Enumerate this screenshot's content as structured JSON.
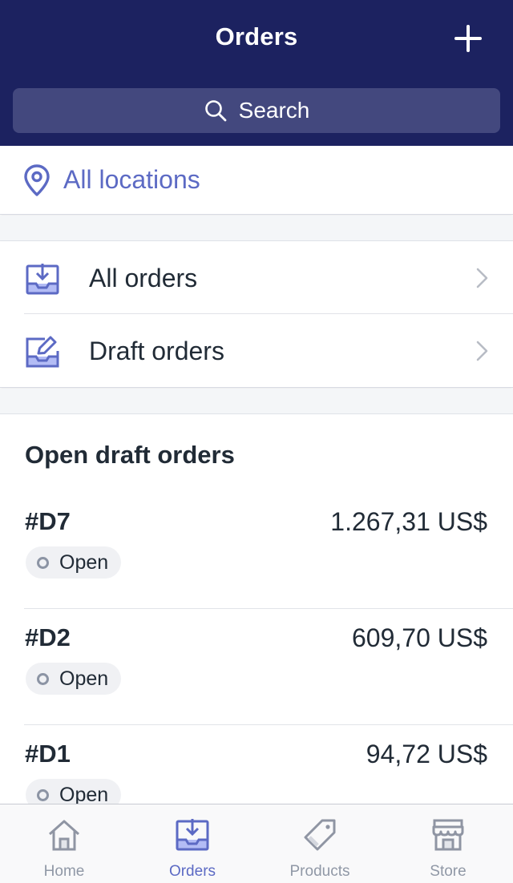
{
  "header": {
    "title": "Orders",
    "add_icon": "plus-icon",
    "search_placeholder": "Search",
    "background_color": "#1c2260"
  },
  "location_filter": {
    "label": "All locations",
    "icon": "location-pin-icon",
    "accent_color": "#5c6ac4"
  },
  "menu": {
    "items": [
      {
        "label": "All orders",
        "icon": "inbox-download-icon"
      },
      {
        "label": "Draft orders",
        "icon": "draft-edit-icon"
      }
    ]
  },
  "draft_section": {
    "title": "Open draft orders",
    "orders": [
      {
        "id": "#D7",
        "amount": "1.267,31 US$",
        "status": "Open"
      },
      {
        "id": "#D2",
        "amount": "609,70 US$",
        "status": "Open"
      },
      {
        "id": "#D1",
        "amount": "94,72 US$",
        "status": "Open"
      }
    ]
  },
  "tabbar": {
    "tabs": [
      {
        "label": "Home",
        "icon": "home-icon",
        "active": false
      },
      {
        "label": "Orders",
        "icon": "orders-icon",
        "active": true
      },
      {
        "label": "Products",
        "icon": "tag-icon",
        "active": false
      },
      {
        "label": "Store",
        "icon": "store-icon",
        "active": false
      }
    ],
    "active_color": "#5c6ac4",
    "inactive_color": "#9098a6"
  }
}
